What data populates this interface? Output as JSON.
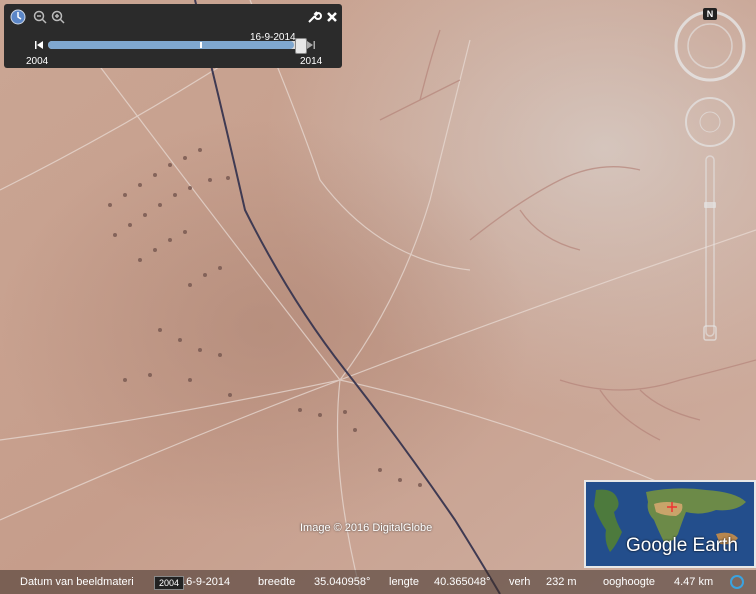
{
  "timebar": {
    "current_date": "16-9-2014",
    "start_year": "2004",
    "end_year": "2014",
    "position_fraction": 0.96,
    "icons": [
      "clock-icon",
      "zoom-out-icon",
      "zoom-in-icon",
      "wrench-icon",
      "close-icon",
      "skip-back-icon",
      "skip-forward-icon"
    ]
  },
  "navigation": {
    "north_label": "N",
    "icons": [
      "compass-ring-icon",
      "look-joystick-icon",
      "move-joystick-icon",
      "zoom-slider-icon"
    ]
  },
  "map": {
    "credit": "Image © 2016 DigitalGlobe"
  },
  "overview_map": {
    "logo_text": "Google Earth"
  },
  "status_bar": {
    "date_label": "Datum van beeldmateri",
    "tooltip_year": "2004",
    "date_value": "16-9-2014",
    "lat_label": "breedte",
    "lat_value": "35.040958°",
    "lon_label": "lengte",
    "lon_value": "40.365048°",
    "elev_label": "verh",
    "elev_value": "232 m",
    "eye_label": "ooghoogte",
    "eye_value": "4.47 km"
  },
  "colors": {
    "terrain": "#c9a391",
    "terrain_light": "#d8bcb0",
    "road": "#3f3a52",
    "track": "#e6d7d0"
  }
}
